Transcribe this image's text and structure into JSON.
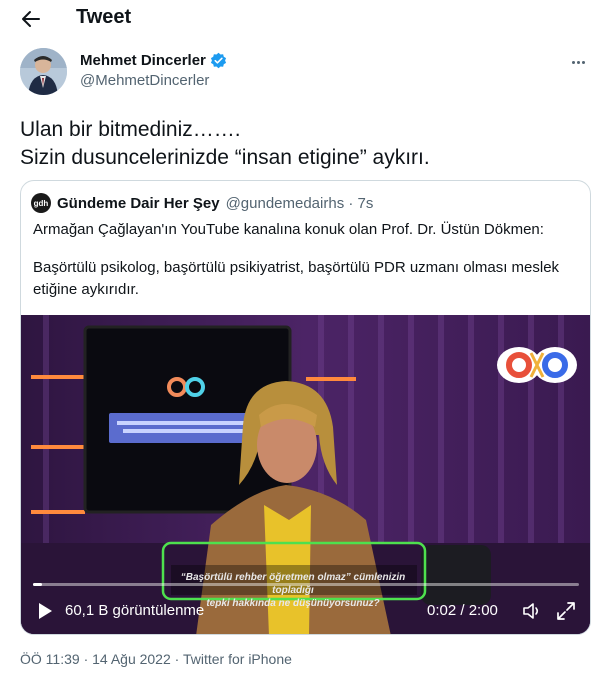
{
  "header": {
    "title": "Tweet",
    "back_icon": "arrow-left-icon"
  },
  "author": {
    "display_name": "Mehmet Dincerler",
    "handle": "@MehmetDincerler",
    "verified_color": "#1d9bf0",
    "more_icon": "more-horizontal-icon"
  },
  "tweet": {
    "lines": [
      "Ulan bir bitmediniz…….",
      "Sizin dusuncelerinizde “insan etigine” aykırı."
    ]
  },
  "quote": {
    "avatar_text": "gdh",
    "name": "Gündeme Dair Her Şey",
    "handle_time": "@gundemedairhs · 7s",
    "text_paragraphs": [
      "Armağan Çağlayan'ın YouTube kanalına konuk olan  Prof. Dr. Üstün Dökmen:",
      "Başörtülü psikolog, başörtülü psikiyatrist, başörtülü PDR uzmanı olması meslek etiğine aykırıdır."
    ],
    "video": {
      "subtitle_line1": "“Başörtülü rehber öğretmen olmaz” cümlenizin topladığı",
      "subtitle_line2": "tepki hakkında ne düşünüyorsunuz?",
      "views": "60,1 B görüntülenme",
      "time": "0:02 / 2:00",
      "progress": 0.017,
      "play_icon": "play-icon",
      "volume_icon": "volume-icon",
      "fullscreen_icon": "fullscreen-icon"
    }
  },
  "meta": {
    "time": "ÖÖ 11:39",
    "date": "14 Ağu 2022",
    "source": "Twitter for iPhone"
  }
}
